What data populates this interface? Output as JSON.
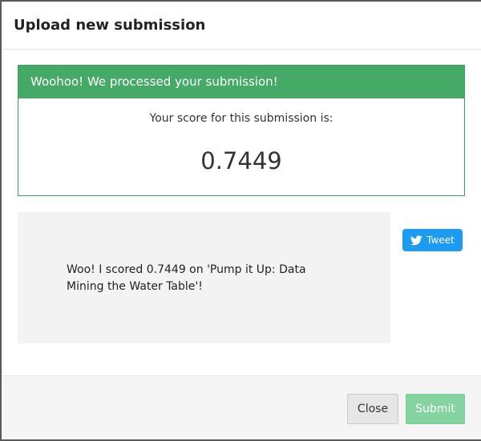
{
  "modal": {
    "title": "Upload new submission"
  },
  "alert": {
    "heading": "Woohoo! We processed your submission!",
    "score_label": "Your score for this submission is:",
    "score_value": "0.7449",
    "accent_color": "#45aa66"
  },
  "share": {
    "text": "Woo! I scored 0.7449 on 'Pump it Up: Data Mining the Water Table'!",
    "tweet_label": "Tweet",
    "tweet_icon": "twitter-bird-icon",
    "tweet_color": "#1d9bf0"
  },
  "footer": {
    "close_label": "Close",
    "submit_label": "Submit"
  }
}
